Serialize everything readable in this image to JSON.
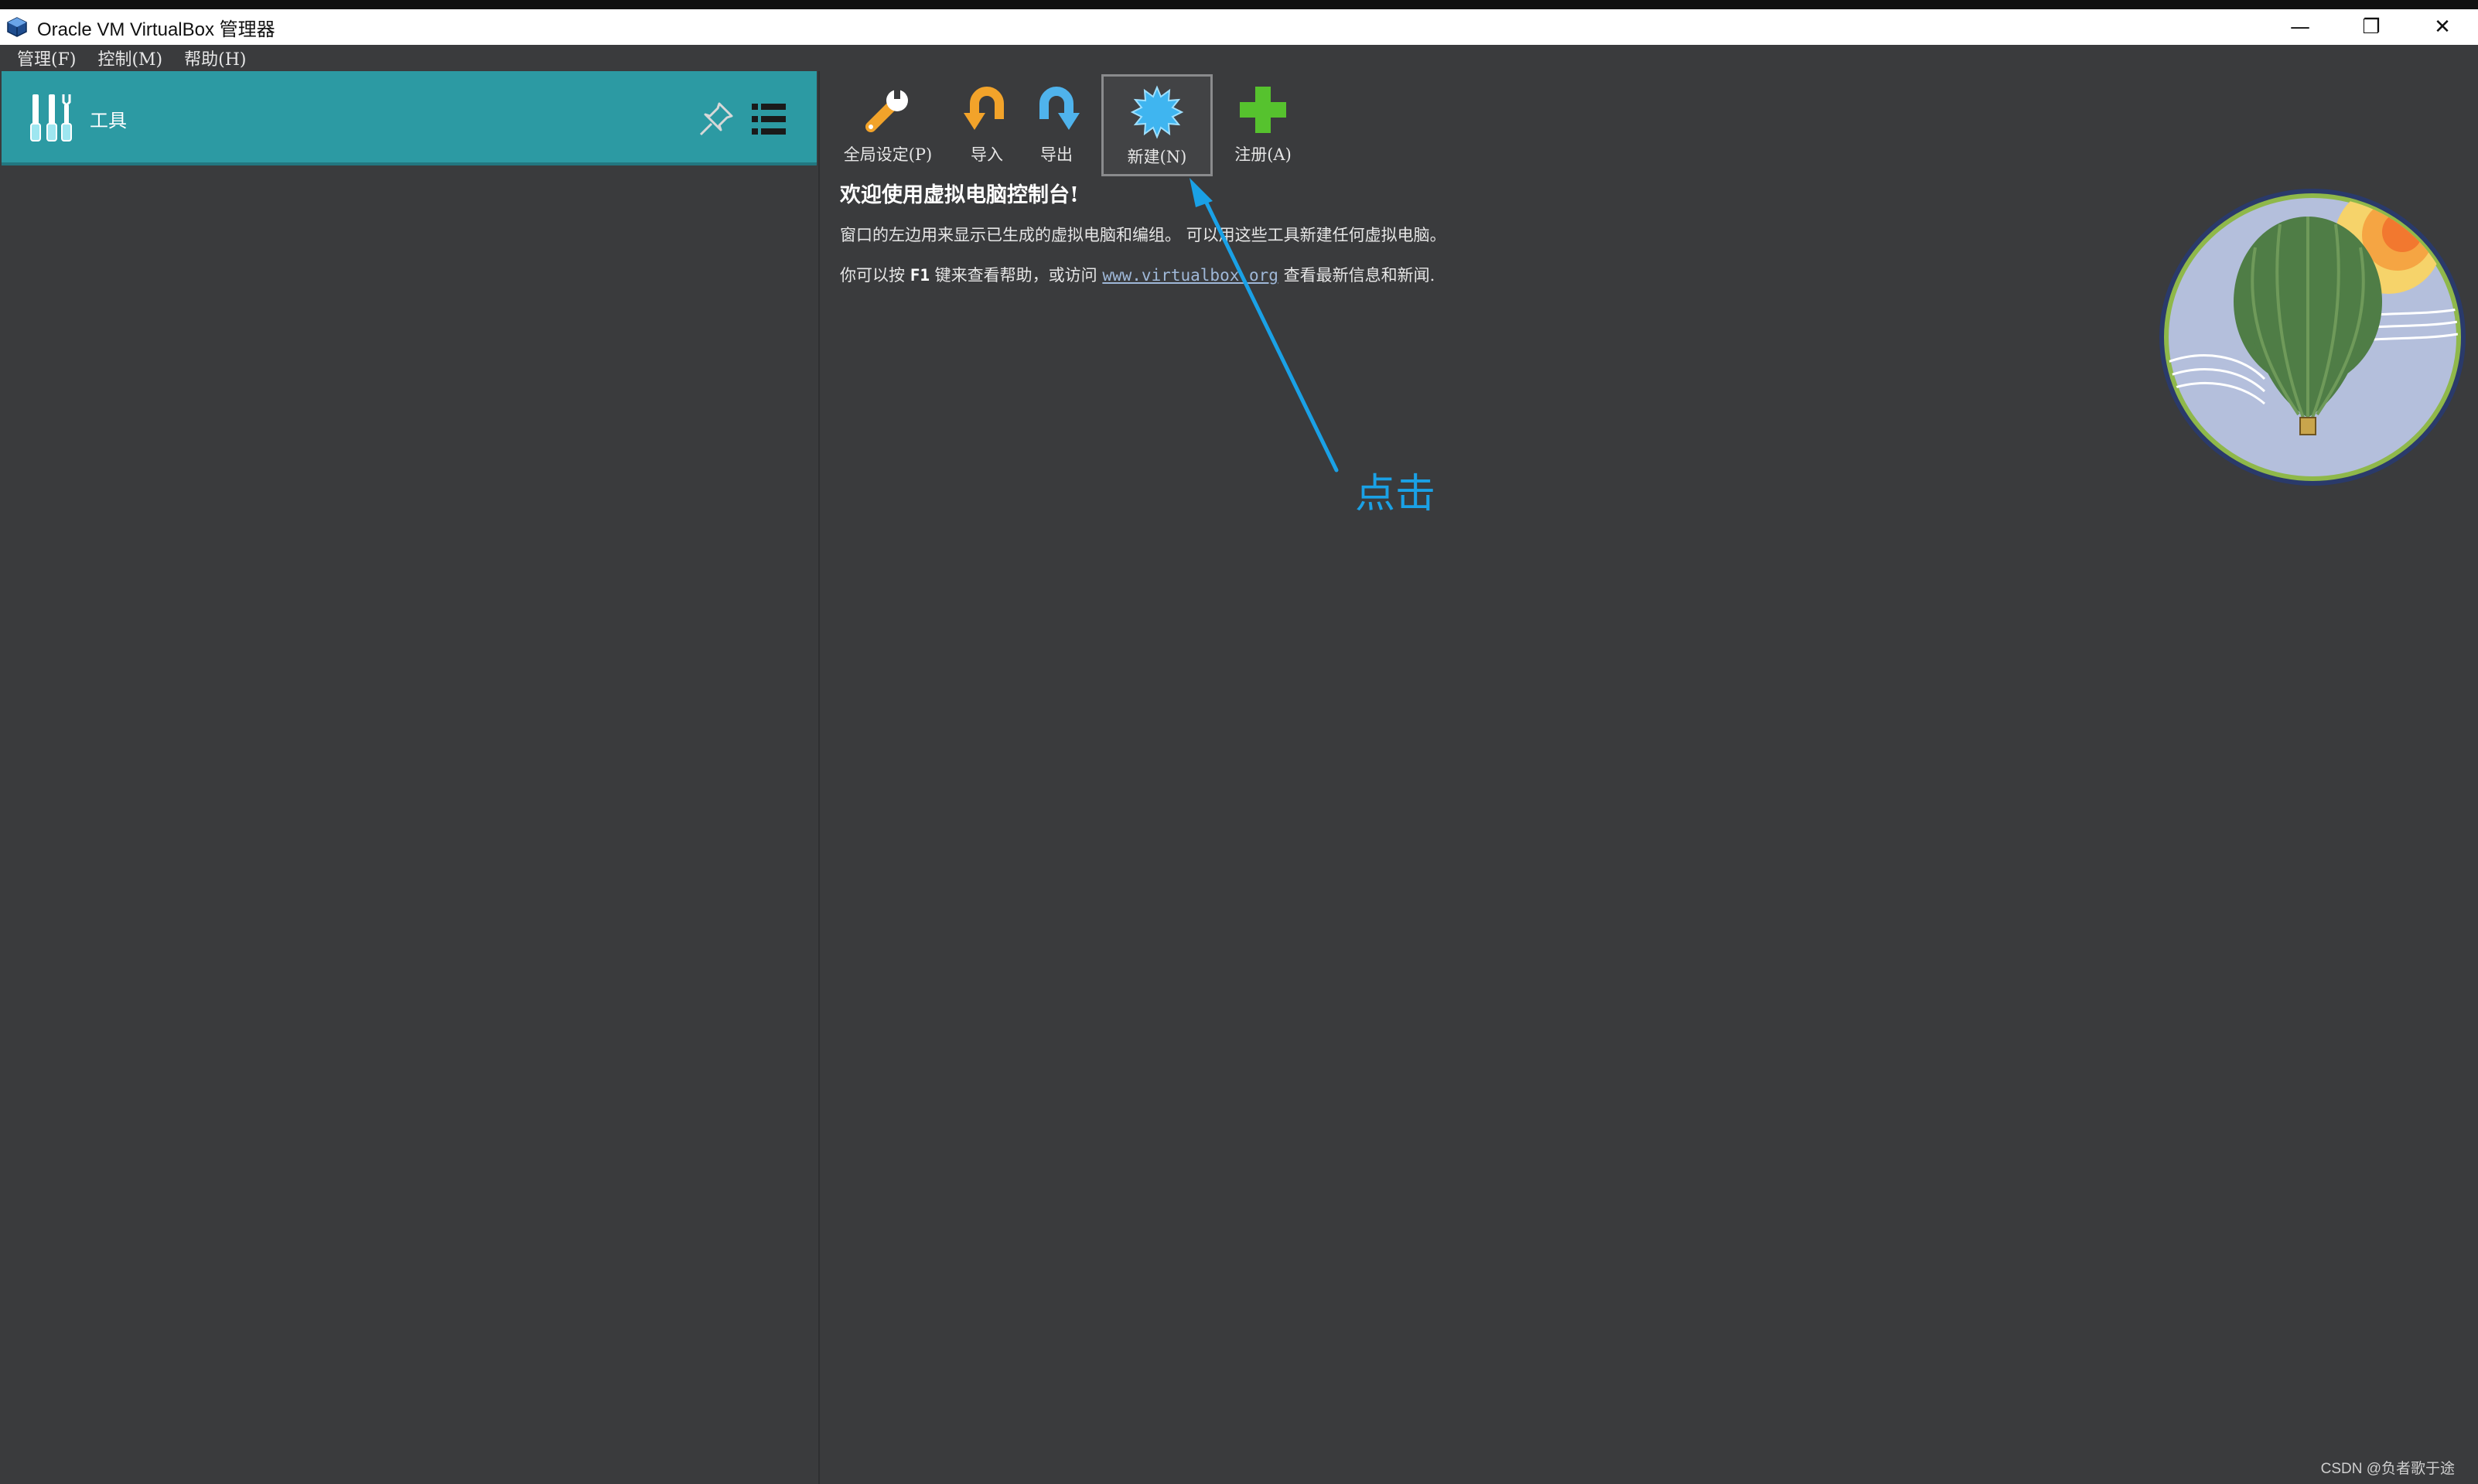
{
  "window": {
    "title": "Oracle VM VirtualBox 管理器",
    "controls": {
      "minimize": "—",
      "restore": "❐",
      "close": "✕"
    }
  },
  "menubar": {
    "items": [
      {
        "label": "管理(F)"
      },
      {
        "label": "控制(M)"
      },
      {
        "label": "帮助(H)"
      }
    ]
  },
  "tools_panel": {
    "label": "工具",
    "icons": [
      "tools-icon",
      "pin-icon",
      "list-menu-icon"
    ]
  },
  "toolbar": {
    "global_settings_label": "全局设定(P)",
    "import_label": "导入",
    "export_label": "导出",
    "new_label": "新建(N)",
    "register_label": "注册(A)"
  },
  "welcome": {
    "title": "欢迎使用虚拟电脑控制台!",
    "line1": "窗口的左边用来显示已生成的虚拟电脑和编组。 可以用这些工具新建任何虚拟电脑。",
    "line2_prefix": "你可以按",
    "line2_key": "F1",
    "line2_middle": "键来查看帮助，或访问",
    "line2_link": "www.virtualbox.org",
    "line2_suffix": "查看最新信息和新闻."
  },
  "annotation": {
    "text": "点击",
    "color": "#1aa1e6"
  },
  "watermark": "CSDN @负者歌于途",
  "colors": {
    "background": "#3a3b3d",
    "tools_header": "#2c9aa3",
    "accent_blue": "#1aa1e6"
  }
}
